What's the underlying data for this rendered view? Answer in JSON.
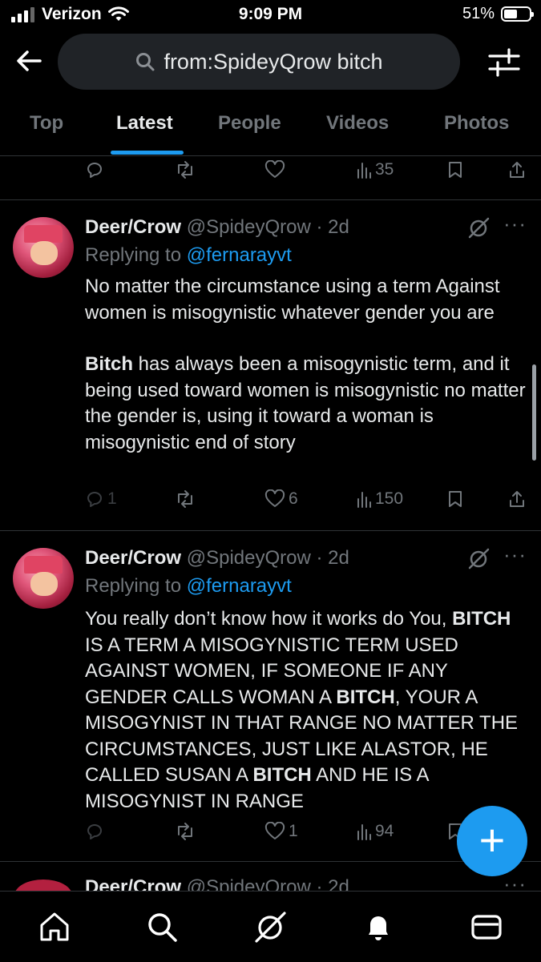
{
  "status_bar": {
    "carrier": "Verizon",
    "time": "9:09 PM",
    "battery": "51%"
  },
  "search": {
    "query": "from:SpideyQrow bitch"
  },
  "tabs": [
    {
      "label": "Top",
      "active": false
    },
    {
      "label": "Latest",
      "active": true
    },
    {
      "label": "People",
      "active": false
    },
    {
      "label": "Videos",
      "active": false
    },
    {
      "label": "Photos",
      "active": false
    }
  ],
  "top_actions": {
    "views": "35"
  },
  "tweets": [
    {
      "name": "Deer/Crow",
      "handle": "@SpideyQrow · 2d",
      "replying_prefix": "Replying to ",
      "replying_to": "@fernarayvt",
      "p1": "No matter the circumstance using a term Against women is misogynistic whatever gender you are",
      "p2_bold": "Bitch",
      "p2_rest": " has always been a misogynistic term, and it being used toward women is misogynistic no matter the gender is, using it toward a woman is misogynistic end of story",
      "replies": "1",
      "reposts": "",
      "likes": "6",
      "views": "150"
    },
    {
      "name": "Deer/Crow",
      "handle": "@SpideyQrow · 2d",
      "replying_prefix": "Replying to ",
      "replying_to": "@fernarayvt",
      "t1": "You really don’t know how it works do You, ",
      "b1": "BITCH",
      "t2": " IS A TERM A MISOGYNISTIC TERM USED AGAINST WOMEN, IF SOMEONE IF ANY GENDER CALLS WOMAN A ",
      "b2": "BITCH",
      "t3": ", YOUR A MISOGYNIST IN THAT RANGE NO MATTER THE CIRCUMSTANCES, JUST LIKE ALASTOR, HE CALLED SUSAN A ",
      "b3": "BITCH",
      "t4": " AND HE IS A MISOGYNIST IN RANGE",
      "replies": "",
      "reposts": "",
      "likes": "1",
      "views": "94"
    }
  ],
  "partial_tweet": {
    "name": "Deer/Crow",
    "handle": "@SpideyQrow · 2d"
  },
  "fab_label": "+",
  "colors": {
    "accent": "#1d9bf0",
    "background": "#000000",
    "muted": "#71767b"
  },
  "nav": [
    "home-icon",
    "search-icon",
    "grok-icon",
    "notifications-icon",
    "messages-icon"
  ]
}
